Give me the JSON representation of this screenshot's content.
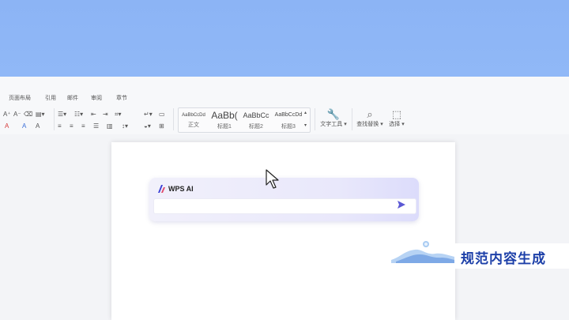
{
  "ribbon": {
    "tabs": [
      "页面布局",
      "引用",
      "邮件",
      "审阅",
      "章节"
    ],
    "styles": [
      {
        "sample": "AaBbCcDd",
        "label": "正文"
      },
      {
        "sample": "AaBb(",
        "label": "标题1"
      },
      {
        "sample": "AaBbCc",
        "label": "标题2"
      },
      {
        "sample": "AaBbCcDd",
        "label": "标题3"
      }
    ],
    "text_tools": "文字工具",
    "find_replace": "查找替换",
    "select": "选择",
    "font_grow": "A⁺",
    "font_shrink": "A⁻",
    "font_color": "A",
    "highlight": "A",
    "char_border": "A"
  },
  "ai": {
    "name": "WPS AI",
    "input_value": ""
  },
  "caption": "规范内容生成",
  "colors": {
    "banner": "#8cb4f5",
    "accent": "#4a47c9",
    "caption": "#1c3fa8"
  },
  "icons": [
    "eraser-icon",
    "bullet-list-icon",
    "numbered-list-icon",
    "indent-icon",
    "outdent-icon",
    "align-left-icon",
    "align-center-icon",
    "align-right-icon",
    "justify-icon",
    "line-spacing-icon",
    "sort-icon",
    "table-border-icon",
    "search-icon",
    "select-icon",
    "send-icon",
    "cursor-icon"
  ]
}
